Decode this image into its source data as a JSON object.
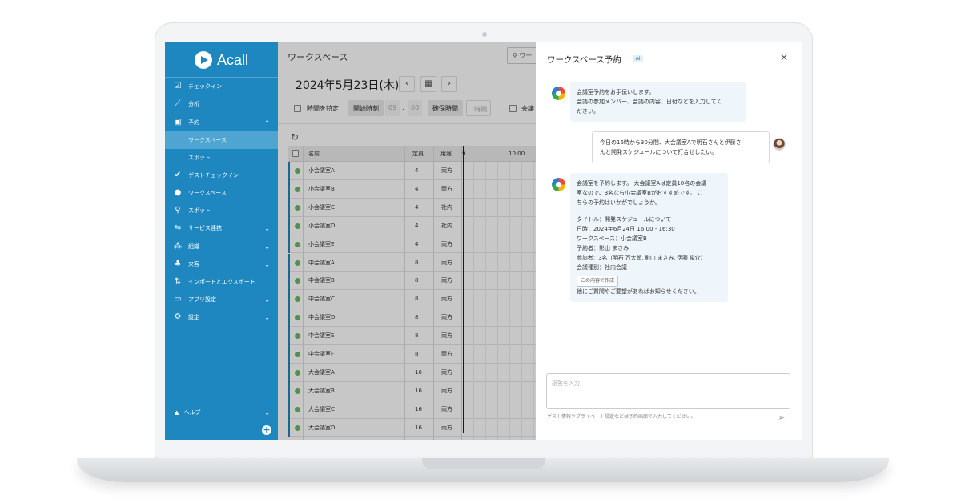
{
  "sidebar": {
    "logo_text": "Acall",
    "items": [
      {
        "icon": "checkbox-icon",
        "glyph": "☑",
        "label": "チェックイン",
        "chevron": ""
      },
      {
        "icon": "chart-icon",
        "glyph": "📈",
        "label": "分析",
        "chevron": ""
      },
      {
        "icon": "calendar-icon",
        "glyph": "📅",
        "label": "予約",
        "chevron": "⌃"
      },
      {
        "icon": "check-icon",
        "glyph": "✔",
        "label": "ゲストチェックイン",
        "chevron": ""
      },
      {
        "icon": "location-icon",
        "glyph": "📍",
        "label": "ワークスペース",
        "chevron": ""
      },
      {
        "icon": "spot-icon",
        "glyph": "⚲",
        "label": "スポット",
        "chevron": ""
      },
      {
        "icon": "link-icon",
        "glyph": "⇋",
        "label": "サービス連携",
        "chevron": "⌄"
      },
      {
        "icon": "organization-icon",
        "glyph": "👥",
        "label": "組織",
        "chevron": "⌄"
      },
      {
        "icon": "visitor-icon",
        "glyph": "👤",
        "label": "来客",
        "chevron": "⌄"
      },
      {
        "icon": "import-export-icon",
        "glyph": "⇅",
        "label": "インポートとエクスポート",
        "chevron": ""
      },
      {
        "icon": "tablet-icon",
        "glyph": "▭",
        "label": "アプリ設定",
        "chevron": "⌄"
      },
      {
        "icon": "gear-icon",
        "glyph": "⚙",
        "label": "設定",
        "chevron": "⌄"
      }
    ],
    "sub_items": [
      "ワークスペース",
      "スポット"
    ],
    "help_label": "ヘルプ",
    "plus": "+"
  },
  "main": {
    "title": "ワークスペース",
    "search_placeholder": "ワー",
    "date": "2024年5月23日(木)",
    "prev": "‹",
    "calendar_glyph": "▦",
    "next": "›",
    "filter": {
      "specify_time": "時間を特定",
      "start_time_label": "開始時刻",
      "start_hour": "09",
      "colon": ":",
      "start_min": "00",
      "duration_label": "確保時間",
      "duration_value": "1時間",
      "meeting_label": "会議"
    },
    "refresh_glyph": "↻",
    "table": {
      "headers": {
        "name": "名前",
        "capacity": "定員",
        "usage": "用途",
        "time_9": "9",
        "time_10": "10:00"
      },
      "rows": [
        {
          "name": "小会議室A",
          "capacity": "4",
          "usage": "両方"
        },
        {
          "name": "小会議室B",
          "capacity": "4",
          "usage": "両方"
        },
        {
          "name": "小会議室C",
          "capacity": "4",
          "usage": "社内"
        },
        {
          "name": "小会議室D",
          "capacity": "4",
          "usage": "社内"
        },
        {
          "name": "小会議室E",
          "capacity": "4",
          "usage": "両方"
        },
        {
          "name": "中会議室A",
          "capacity": "8",
          "usage": "両方"
        },
        {
          "name": "中会議室B",
          "capacity": "8",
          "usage": "両方"
        },
        {
          "name": "中会議室C",
          "capacity": "8",
          "usage": "両方"
        },
        {
          "name": "中会議室D",
          "capacity": "8",
          "usage": "両方"
        },
        {
          "name": "中会議室E",
          "capacity": "8",
          "usage": "両方"
        },
        {
          "name": "中会議室F",
          "capacity": "8",
          "usage": "両方"
        },
        {
          "name": "大会議室A",
          "capacity": "16",
          "usage": "両方"
        },
        {
          "name": "大会議室B",
          "capacity": "16",
          "usage": "両方"
        },
        {
          "name": "大会議室C",
          "capacity": "16",
          "usage": "両方"
        },
        {
          "name": "大会議室D",
          "capacity": "16",
          "usage": "両方"
        }
      ]
    }
  },
  "chat": {
    "title": "ワークスペース予約",
    "badge": "AI",
    "close": "✕",
    "bot_message_1": [
      "会議室予約をお手伝いします。",
      "会議の参加メンバー、会議の内容、日付などを入力してく",
      "ださい。"
    ],
    "user_message": [
      "今日の16時から30分間、大会議室Aで明石さんと伊藤さ",
      "んと開発スケジュールについて打合せしたい。"
    ],
    "bot_message_2": {
      "intro": [
        "会議室を予約します。 大会議室Aは定員10名の会議",
        "室なので、3名なら小会議室Bがおすすめです。 こ",
        "ちらの予約はいかがでしょうか。"
      ],
      "details": [
        "タイトル：開発スケジュールについて",
        "日時：2024年6月24日 16:00 - 16:30",
        "ワークスペース：小会議室B",
        "予約者：影山 まさみ",
        "参加者：3名（明石 万太郎, 影山 まさみ, 伊藤 俊介）",
        "会議種別：社内会議"
      ],
      "button": "この内容で作成",
      "closing": "他にご質問やご要望があればお知らせください。"
    },
    "input_placeholder": "返答を入力",
    "hint": "ゲスト情報やプライベート設定などは予約画面で入力してください。",
    "send": "➢"
  }
}
